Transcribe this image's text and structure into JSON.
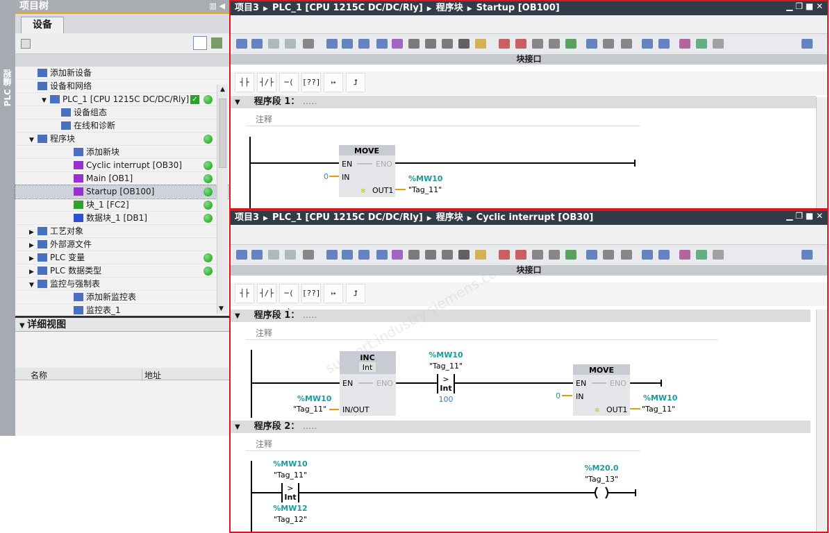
{
  "side_strip": {
    "label": "PLC 编程"
  },
  "project_tree": {
    "title": "项目树",
    "tab": "设备",
    "items": [
      {
        "label": "添加新设备",
        "indent": 1
      },
      {
        "label": "设备和网络",
        "indent": 1
      },
      {
        "label": "PLC_1 [CPU 1215C DC/DC/Rly]",
        "indent": 0,
        "expanded": true,
        "check": true,
        "status": "ok"
      },
      {
        "label": "设备组态",
        "indent": 2
      },
      {
        "label": "在线和诊断",
        "indent": 2
      },
      {
        "label": "程序块",
        "indent": 1,
        "expanded": true,
        "status": "ok"
      },
      {
        "label": "添加新块",
        "indent": 3
      },
      {
        "label": "Cyclic interrupt [OB30]",
        "indent": 3,
        "status": "ok"
      },
      {
        "label": "Main [OB1]",
        "indent": 3,
        "status": "ok"
      },
      {
        "label": "Startup [OB100]",
        "indent": 3,
        "status": "ok",
        "selected": true
      },
      {
        "label": "块_1 [FC2]",
        "indent": 3,
        "status": "ok"
      },
      {
        "label": "数据块_1 [DB1]",
        "indent": 3,
        "status": "ok"
      },
      {
        "label": "工艺对象",
        "indent": 1,
        "collapsed": true
      },
      {
        "label": "外部源文件",
        "indent": 1,
        "collapsed": true
      },
      {
        "label": "PLC 变量",
        "indent": 1,
        "collapsed": true,
        "status": "ok"
      },
      {
        "label": "PLC 数据类型",
        "indent": 1,
        "collapsed": true,
        "status": "ok"
      },
      {
        "label": "监控与强制表",
        "indent": 1,
        "expanded": true
      },
      {
        "label": "添加新监控表",
        "indent": 3
      },
      {
        "label": "监控表_1",
        "indent": 3
      }
    ],
    "detail_view": {
      "title": "详细视图",
      "col_name": "名称",
      "col_address": "地址"
    }
  },
  "editor_top": {
    "breadcrumb": [
      "项目3",
      "PLC_1 [CPU 1215C DC/DC/Rly]",
      "程序块",
      "Startup [OB100]"
    ],
    "interface": "块接口",
    "network1": {
      "title": "程序段 1：",
      "dots": ".....",
      "comment": "注释",
      "move": {
        "name": "MOVE",
        "en": "EN",
        "eno": "ENO",
        "in": "IN",
        "out": "OUT1",
        "in_val": "0",
        "out_addr": "%MW10",
        "out_tag": "\"Tag_11\""
      }
    }
  },
  "editor_bottom": {
    "breadcrumb": [
      "项目3",
      "PLC_1 [CPU 1215C DC/DC/Rly]",
      "程序块",
      "Cyclic interrupt [OB30]"
    ],
    "interface": "块接口",
    "network1": {
      "title": "程序段 1：",
      "dots": ".....",
      "comment": "注释",
      "inc": {
        "name": "INC",
        "type": "Int",
        "en": "EN",
        "eno": "ENO",
        "inout": "IN/OUT",
        "addr": "%MW10",
        "tag": "\"Tag_11\""
      },
      "cmp": {
        "op": ">",
        "type": "Int",
        "addr": "%MW10",
        "tag": "\"Tag_11\"",
        "value": "100"
      },
      "move": {
        "name": "MOVE",
        "en": "EN",
        "eno": "ENO",
        "in": "IN",
        "out": "OUT1",
        "in_val": "0",
        "out_addr": "%MW10",
        "out_tag": "\"Tag_11\""
      }
    },
    "network2": {
      "title": "程序段 2：",
      "dots": ".....",
      "comment": "注释",
      "cmp": {
        "op": ">",
        "type": "Int",
        "addr1": "%MW10",
        "tag1": "\"Tag_11\"",
        "addr2": "%MW12",
        "tag2": "\"Tag_12\""
      },
      "coil": {
        "addr": "%M20.0",
        "tag": "\"Tag_13\""
      }
    }
  },
  "lad_instructions": [
    "normally-open-contact",
    "normally-closed-contact",
    "coil",
    "empty-box",
    "open-branch",
    "close-branch"
  ],
  "watermark": "support.industry.siemens.com",
  "colors": {
    "highlight_border": "#e0141e",
    "operand": "#1a9aa0",
    "wire_orange": "#e0a000",
    "status_ok": "#1a9a1a"
  }
}
